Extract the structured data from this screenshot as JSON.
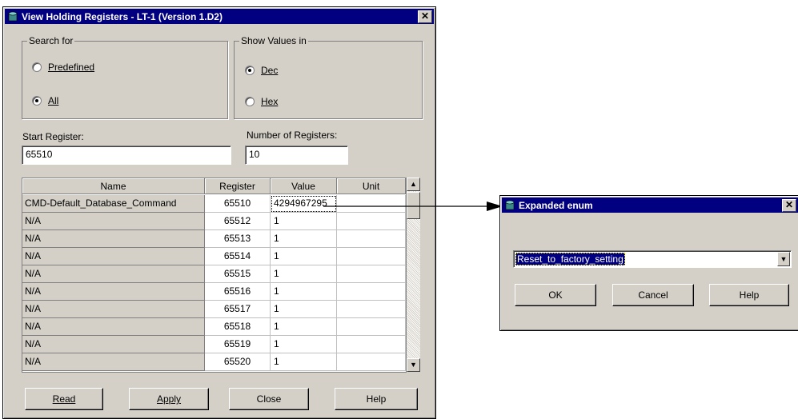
{
  "main_window": {
    "title": "View Holding Registers - LT-1 (Version 1.D2)",
    "close_glyph": "✕",
    "search_group": {
      "legend": "Search for",
      "options": [
        {
          "label": "Predefined",
          "selected": false
        },
        {
          "label": "All",
          "selected": true
        }
      ]
    },
    "show_group": {
      "legend": "Show Values in",
      "options": [
        {
          "label": "Dec",
          "selected": true
        },
        {
          "label": "Hex",
          "selected": false
        }
      ]
    },
    "start_register": {
      "label": "Start Register:",
      "value": "65510"
    },
    "number_of_registers": {
      "label": "Number of Registers:",
      "value": "10"
    },
    "table": {
      "columns": [
        "Name",
        "Register",
        "Value",
        "Unit"
      ],
      "rows": [
        {
          "name": "CMD-Default_Database_Command",
          "register": "65510",
          "value": "4294967295",
          "unit": ""
        },
        {
          "name": "N/A",
          "register": "65512",
          "value": "1",
          "unit": ""
        },
        {
          "name": "N/A",
          "register": "65513",
          "value": "1",
          "unit": ""
        },
        {
          "name": "N/A",
          "register": "65514",
          "value": "1",
          "unit": ""
        },
        {
          "name": "N/A",
          "register": "65515",
          "value": "1",
          "unit": ""
        },
        {
          "name": "N/A",
          "register": "65516",
          "value": "1",
          "unit": ""
        },
        {
          "name": "N/A",
          "register": "65517",
          "value": "1",
          "unit": ""
        },
        {
          "name": "N/A",
          "register": "65518",
          "value": "1",
          "unit": ""
        },
        {
          "name": "N/A",
          "register": "65519",
          "value": "1",
          "unit": ""
        },
        {
          "name": "N/A",
          "register": "65520",
          "value": "1",
          "unit": ""
        }
      ]
    },
    "buttons": {
      "read": "Read",
      "apply": "Apply",
      "close": "Close",
      "help": "Help"
    }
  },
  "enum_window": {
    "title": "Expanded enum",
    "close_glyph": "✕",
    "selected_option": "Reset_to_factory_setting",
    "buttons": {
      "ok": "OK",
      "cancel": "Cancel",
      "help": "Help"
    }
  },
  "icons": [
    "database-icon",
    "close-icon",
    "scroll-up-icon",
    "scroll-down-icon",
    "dropdown-arrow-icon"
  ],
  "colors": {
    "titlebar": "#000080",
    "face": "#d4d0c8",
    "highlight": "#000080"
  }
}
